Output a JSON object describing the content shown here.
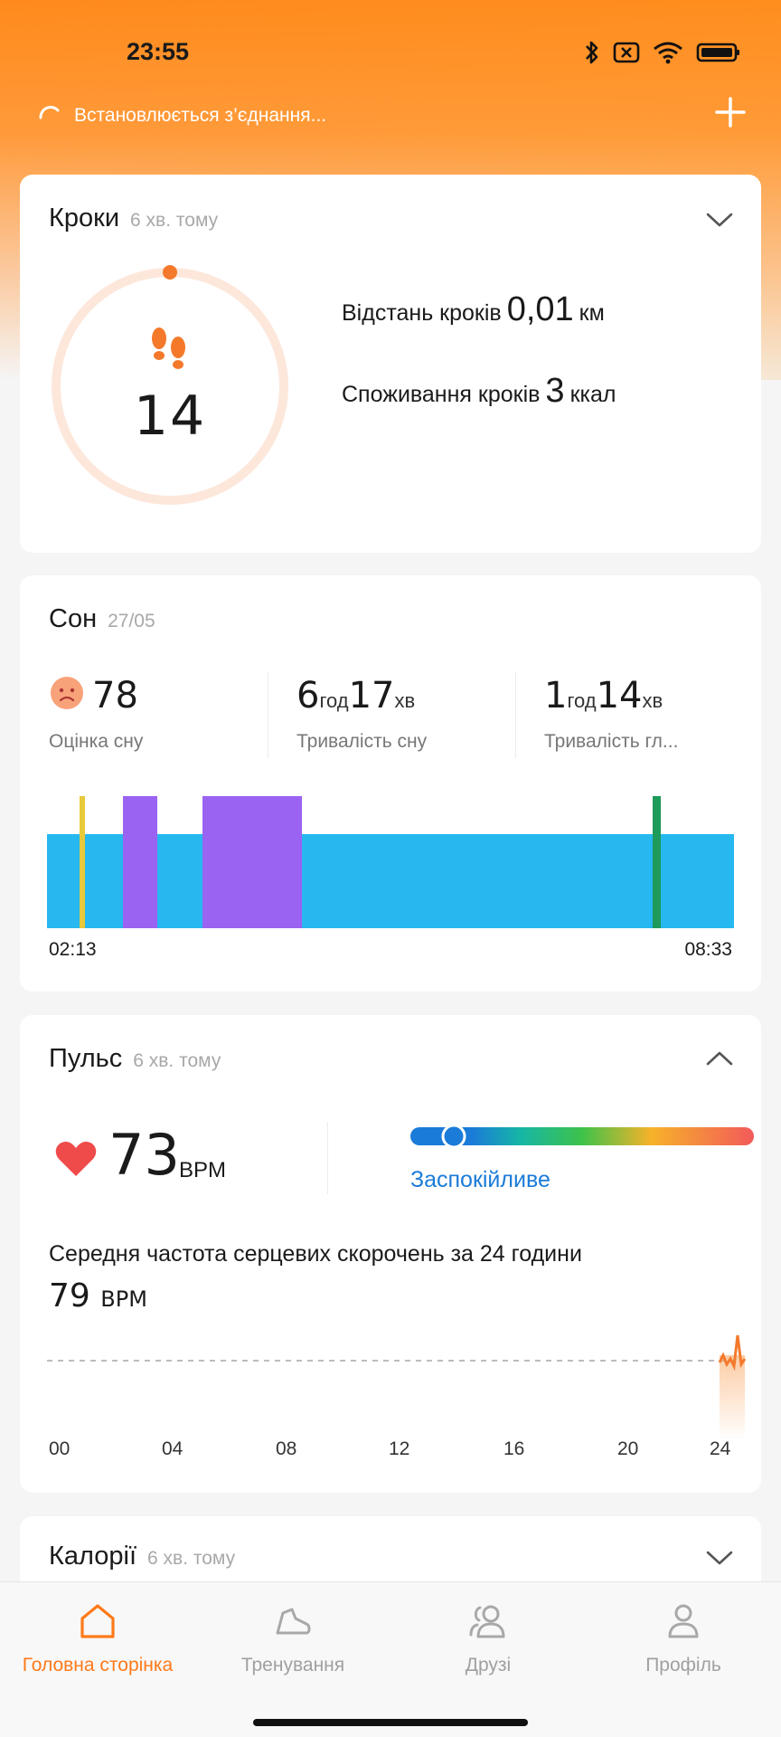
{
  "status_bar": {
    "time": "23:55",
    "icons": [
      "bluetooth-icon",
      "sim-off-icon",
      "wifi-icon",
      "battery-icon"
    ]
  },
  "header": {
    "connection_text": "Встановлюється з’єднання...",
    "add_icon": "plus-icon"
  },
  "steps": {
    "title": "Кроки",
    "updated": "6 хв. тому",
    "count": "14",
    "distance_label": "Відстань кроків",
    "distance_value": "0,01",
    "distance_unit": "км",
    "calories_label": "Споживання кроків",
    "calories_value": "3",
    "calories_unit": "ккал",
    "accent_color": "#f4792b"
  },
  "sleep": {
    "title": "Сон",
    "date": "27/05",
    "score_value": "78",
    "score_label": "Оцінка сну",
    "duration_hours": "6",
    "duration_hours_unit": "год",
    "duration_minutes": "17",
    "duration_minutes_unit": "хв",
    "duration_label": "Тривалість сну",
    "deep_hours": "1",
    "deep_hours_unit": "год",
    "deep_minutes": "14",
    "deep_minutes_unit": "хв",
    "deep_label": "Тривалість гл...",
    "start_time": "02:13",
    "end_time": "08:33",
    "colors": {
      "light": "#27b8ef",
      "deep": "#9a63f2",
      "awake": "#e8c93a",
      "rem": "#1e9a5a"
    }
  },
  "pulse": {
    "title": "Пульс",
    "updated": "6 хв. тому",
    "value": "73",
    "unit": "BPM",
    "zone_label": "Заспокійливе",
    "avg_label": "Середня частота серцевих скорочень за 24 години",
    "avg_value": "79",
    "avg_unit": "BPM",
    "x_ticks": [
      "00",
      "04",
      "08",
      "12",
      "16",
      "20",
      "24"
    ],
    "heart_color": "#ef4b4b",
    "zone_color": "#1b7bd8"
  },
  "calories": {
    "title": "Калорії",
    "updated": "6 хв. тому"
  },
  "nav": {
    "home": "Головна сторінка",
    "workouts": "Тренування",
    "friends": "Друзі",
    "profile": "Профіль",
    "active_color": "#ff7a1a"
  }
}
